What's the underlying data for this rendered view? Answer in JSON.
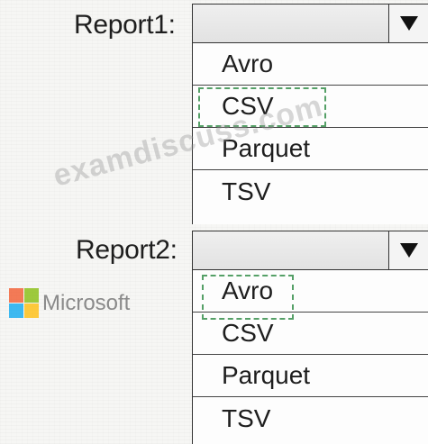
{
  "report1": {
    "label": "Report1:",
    "options": [
      "Avro",
      "CSV",
      "Parquet",
      "TSV"
    ],
    "selected": "CSV"
  },
  "report2": {
    "label": "Report2:",
    "options": [
      "Avro",
      "CSV",
      "Parquet",
      "TSV"
    ],
    "selected": "Avro"
  },
  "watermark": "examdiscuss.com",
  "logo": {
    "text": "Microsoft",
    "colors": [
      "#f25022",
      "#7fba00",
      "#00a4ef",
      "#ffb900"
    ]
  },
  "icons": {
    "dropdown": "dropdown-arrow-icon"
  }
}
